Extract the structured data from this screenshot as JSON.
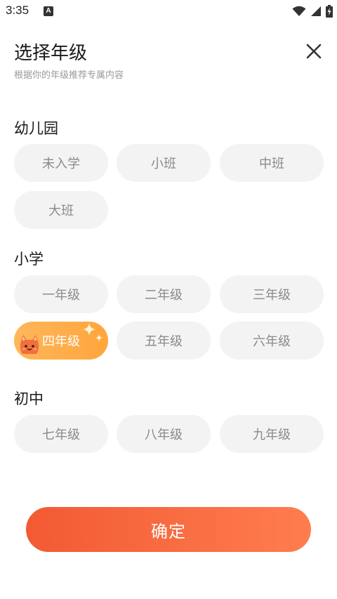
{
  "status_bar": {
    "time": "3:35",
    "notification_letter": "A"
  },
  "header": {
    "title": "选择年级",
    "subtitle": "根据你的年级推荐专属内容"
  },
  "sections": [
    {
      "title": "幼儿园",
      "options": [
        "未入学",
        "小班",
        "中班",
        "大班"
      ]
    },
    {
      "title": "小学",
      "options": [
        "一年级",
        "二年级",
        "三年级",
        "四年级",
        "五年级",
        "六年级"
      ]
    },
    {
      "title": "初中",
      "options": [
        "七年级",
        "八年级",
        "九年级"
      ]
    }
  ],
  "selected_option": "四年级",
  "confirm_label": "确定",
  "colors": {
    "chip_bg": "#f3f3f3",
    "chip_text": "#8a8a8a",
    "selected_bg": "#ffae4d",
    "confirm_start": "#f25a33",
    "confirm_end": "#ff7d4f"
  },
  "icons": [
    "wifi-icon",
    "signal-icon",
    "battery-icon",
    "close-icon",
    "mascot-icon",
    "sparkle-icon"
  ]
}
